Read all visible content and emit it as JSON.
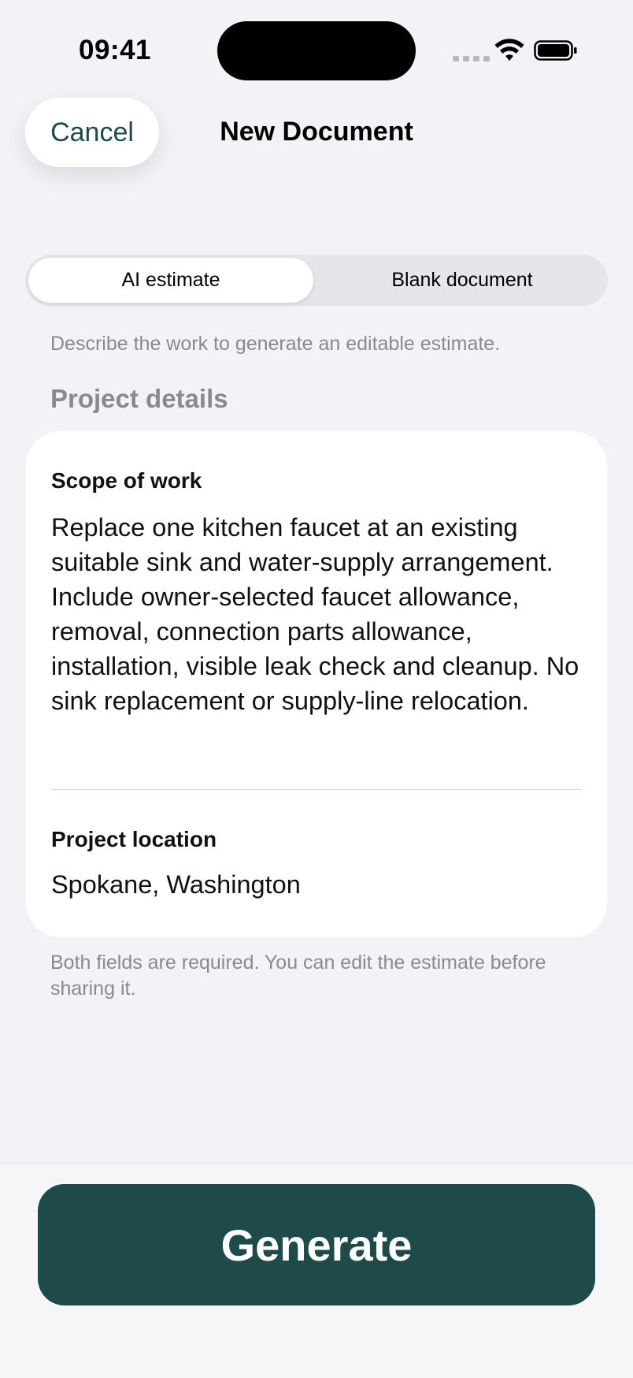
{
  "status_bar": {
    "time": "09:41",
    "icons": [
      "signal-icon",
      "wifi-icon",
      "battery-icon"
    ]
  },
  "nav": {
    "cancel_label": "Cancel",
    "title": "New Document"
  },
  "mode_switch": {
    "options": [
      "AI estimate",
      "Blank document"
    ],
    "selected": "AI estimate"
  },
  "hint": "Describe the work to generate an editable estimate.",
  "section_title": "Project details",
  "form": {
    "scope_label": "Scope of work",
    "scope_value": "Replace one kitchen faucet at an existing suitable sink and water-supply arrangement. Include owner-selected faucet allowance, removal, connection parts allowance, installation, visible leak check and cleanup. No sink replacement or supply-line relocation.",
    "location_label": "Project location",
    "location_value": "Spokane, Washington"
  },
  "footnote": "Both fields are required. You can edit the estimate before sharing it.",
  "generate_label": "Generate",
  "colors": {
    "accent": "#1F4A4A",
    "background": "#F2F2F7",
    "secondary_text": "#8A8A8E"
  }
}
